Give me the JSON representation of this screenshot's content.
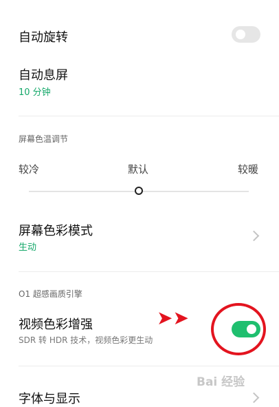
{
  "auto_rotate": {
    "label": "自动旋转",
    "enabled": false
  },
  "auto_sleep": {
    "label": "自动息屏",
    "value": "10 分钟"
  },
  "color_temp": {
    "header": "屏幕色温调节",
    "cool_label": "较冷",
    "default_label": "默认",
    "warm_label": "较暖",
    "level": 0.5
  },
  "color_mode": {
    "label": "屏幕色彩模式",
    "value": "生动"
  },
  "o1_section": {
    "header": "O1 超感画质引擎"
  },
  "video_enhance": {
    "label": "视频色彩增强",
    "description": "SDR 转 HDR 技术，视频色彩更生动",
    "enabled": true
  },
  "font_display": {
    "label": "字体与显示"
  },
  "annotation": {
    "arrows": "➤➤",
    "highlight_color": "#e3141f"
  },
  "watermark": {
    "text": "Bai 经验"
  },
  "colors": {
    "accent_green": "#1fbf6f",
    "value_green": "#15a86a"
  }
}
